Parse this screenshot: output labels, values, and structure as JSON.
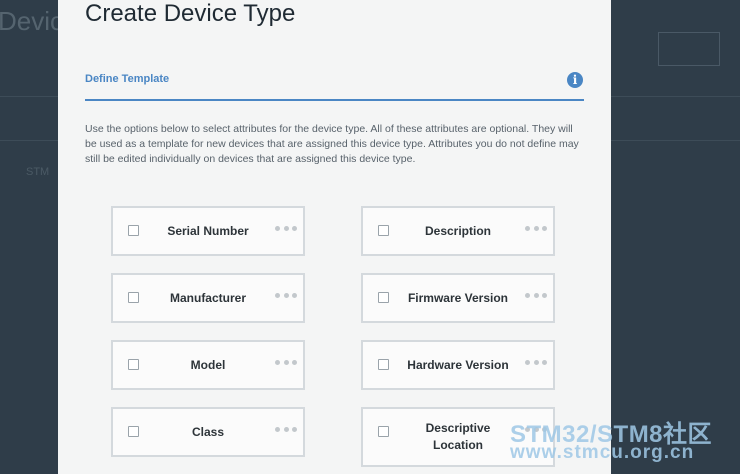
{
  "background": {
    "title": "Devic",
    "subtitle": "",
    "button_label": "",
    "row_label": "STM",
    "row_sub": ""
  },
  "modal": {
    "title": "Create Device Type",
    "section_label": "Define Template",
    "intro": "Use the options below to select attributes for the device type. All of these attributes are optional. They will be used as a template for new devices that are assigned this device type. Attributes you do not define may still be edited individually on devices that are assigned this device type.",
    "attributes": [
      {
        "label": "Serial Number",
        "checked": false
      },
      {
        "label": "Description",
        "checked": false
      },
      {
        "label": "Manufacturer",
        "checked": false
      },
      {
        "label": "Firmware Version",
        "checked": false
      },
      {
        "label": "Model",
        "checked": false
      },
      {
        "label": "Hardware Version",
        "checked": false
      },
      {
        "label": "Class",
        "checked": false
      },
      {
        "label": "Descriptive Location",
        "checked": false
      }
    ]
  },
  "watermark": {
    "line1": "STM32/STM8社区",
    "line2": "www.stmcu.org.cn"
  },
  "colors": {
    "accent": "#4a86c4",
    "overlay": "#2f3d49"
  }
}
